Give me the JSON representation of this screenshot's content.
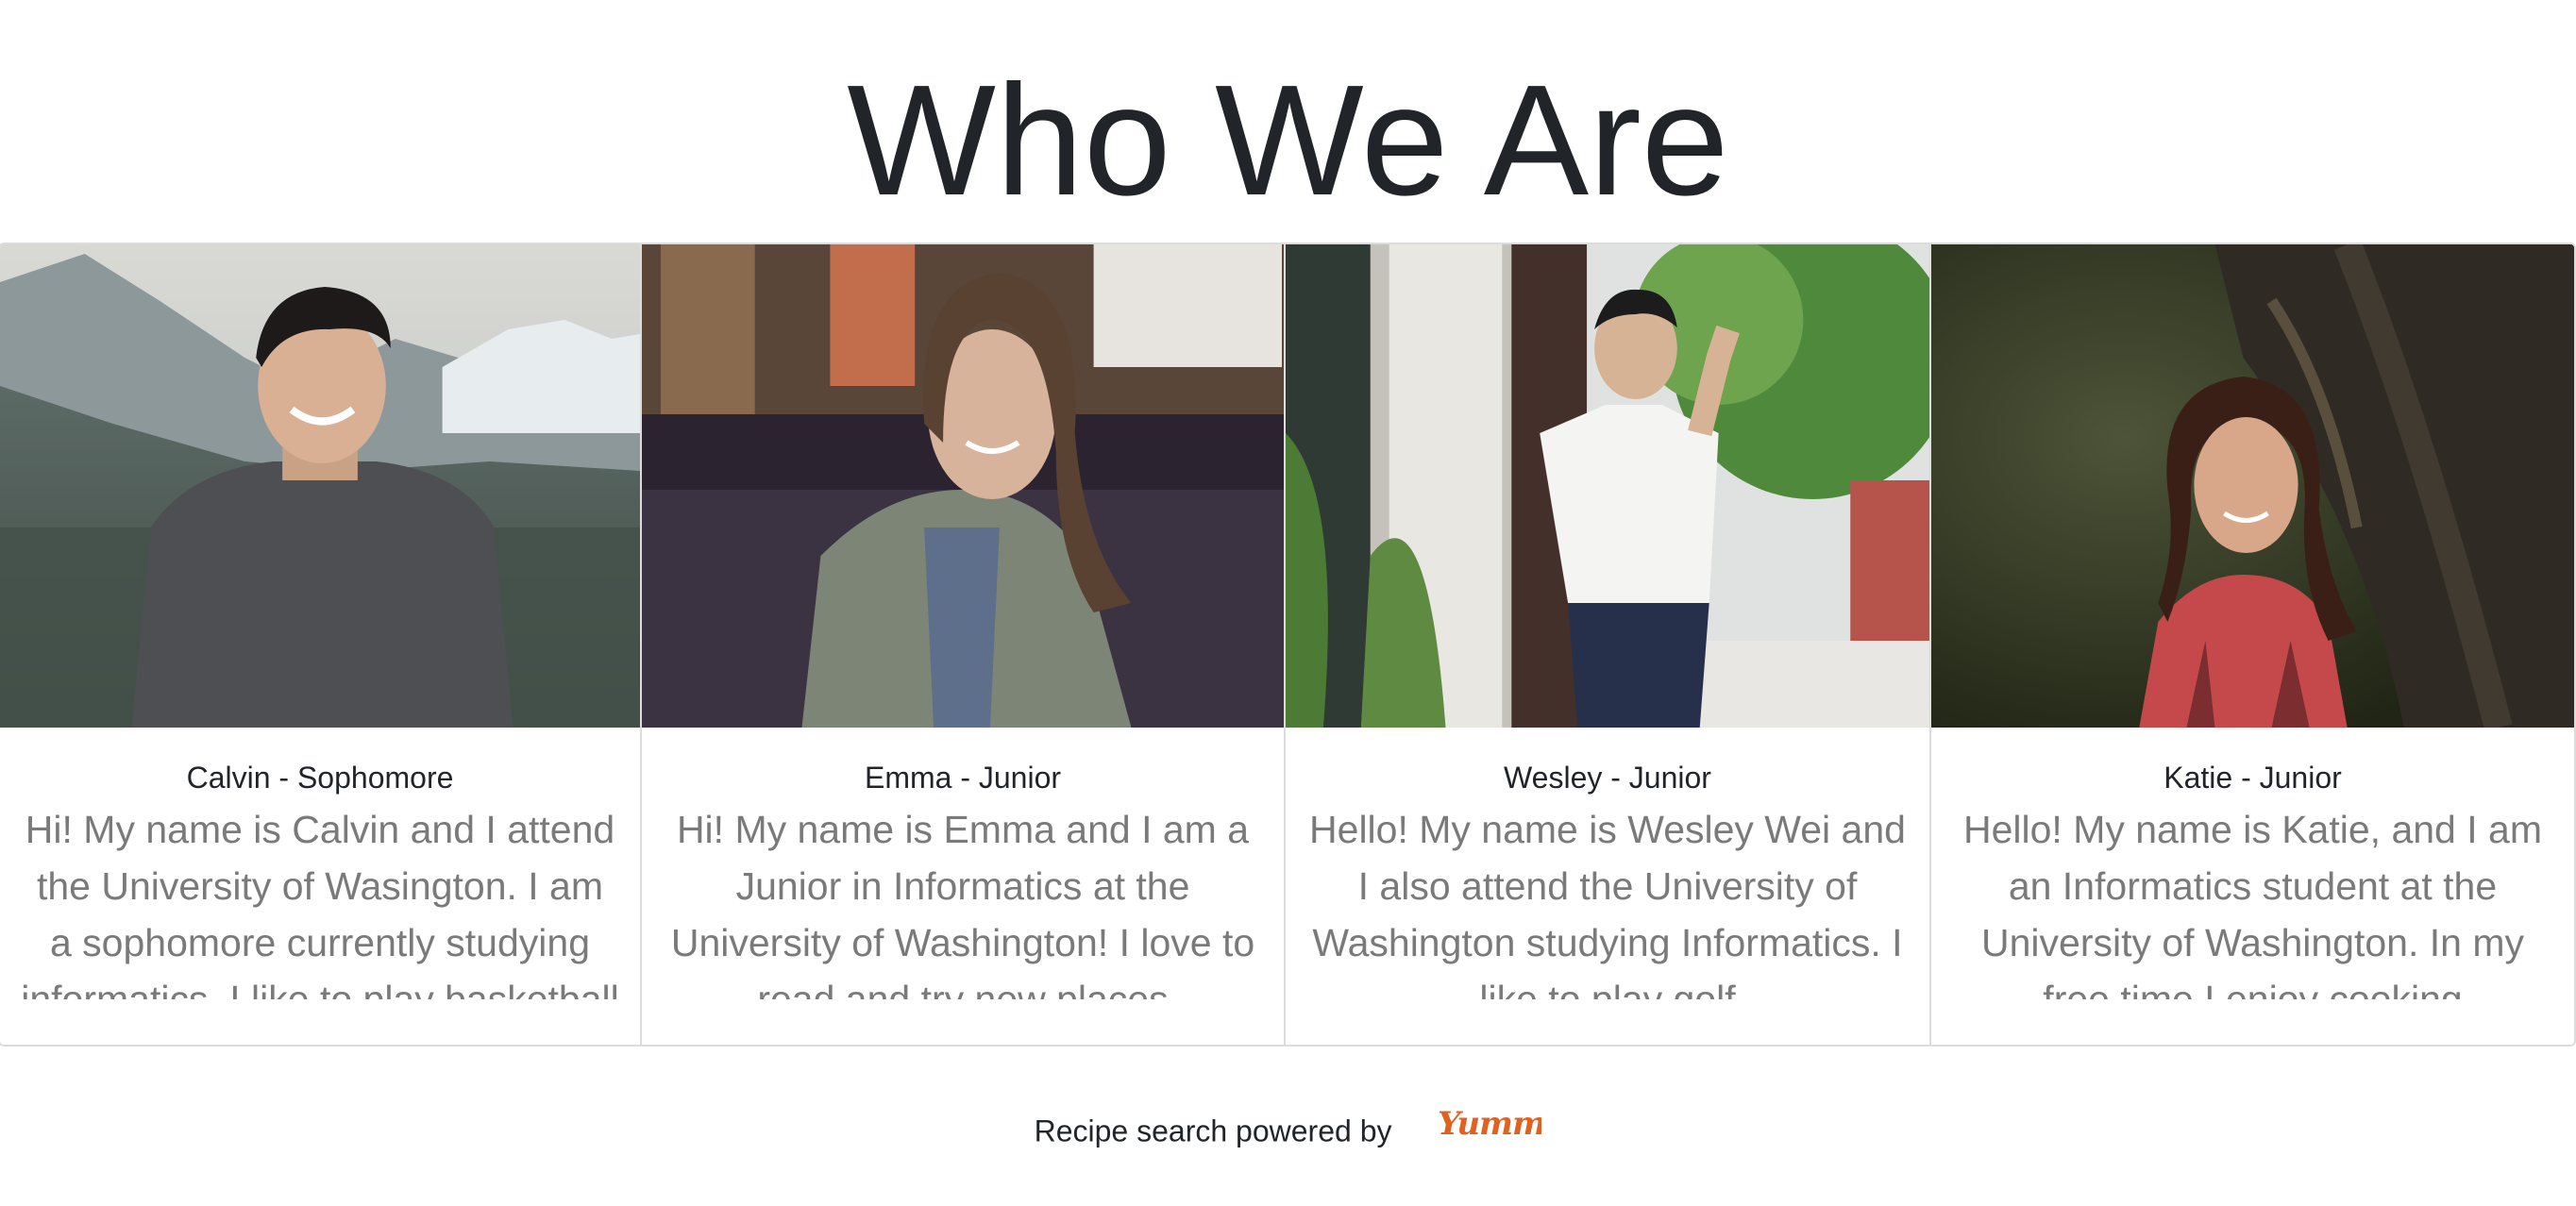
{
  "page": {
    "title": "Who We Are"
  },
  "team": [
    {
      "name": "Calvin - Sophomore",
      "bio": "Hi! My name is Calvin and I attend the University of Wasington. I am a sophomore currently studying informatics. I like to play basketball",
      "photo_icon": "person-photo"
    },
    {
      "name": "Emma - Junior",
      "bio": "Hi! My name is Emma and I am a Junior in Informatics at the University of Washington! I love to read and try new places",
      "photo_icon": "person-photo"
    },
    {
      "name": "Wesley - Junior",
      "bio": "Hello! My name is Wesley Wei and I also attend the University of Washington studying Informatics. I like to play golf",
      "photo_icon": "person-photo"
    },
    {
      "name": "Katie - Junior",
      "bio": "Hello! My name is Katie, and I am an Informatics student at the University of Washington. In my free time I enjoy cooking",
      "photo_icon": "person-photo"
    }
  ],
  "footer": {
    "text": "Recipe search powered by",
    "logo_text": "Yummly"
  },
  "colors": {
    "title": "#212529",
    "bio": "#7a7a7a",
    "border": "#dcdcdc",
    "yummly": "#e16120"
  }
}
